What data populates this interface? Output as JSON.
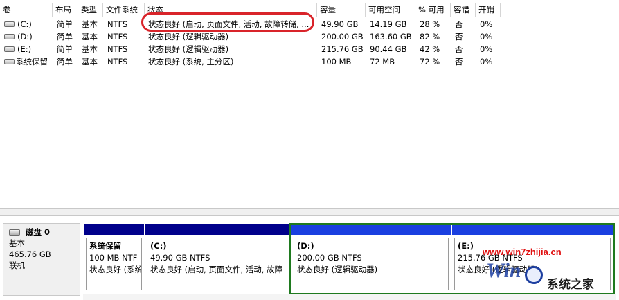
{
  "columns": [
    "卷",
    "布局",
    "类型",
    "文件系统",
    "状态",
    "容量",
    "可用空间",
    "% 可用",
    "容错",
    "开销"
  ],
  "volumes": [
    {
      "name": "(C:)",
      "layout": "简单",
      "type": "基本",
      "fs": "NTFS",
      "status": "状态良好 (启动, 页面文件, 活动, 故障转储, ...",
      "capacity": "49.90 GB",
      "free": "14.19 GB",
      "pct": "28 %",
      "fault": "否",
      "overhead": "0%"
    },
    {
      "name": "(D:)",
      "layout": "简单",
      "type": "基本",
      "fs": "NTFS",
      "status": "状态良好 (逻辑驱动器)",
      "capacity": "200.00 GB",
      "free": "163.60 GB",
      "pct": "82 %",
      "fault": "否",
      "overhead": "0%"
    },
    {
      "name": "(E:)",
      "layout": "简单",
      "type": "基本",
      "fs": "NTFS",
      "status": "状态良好 (逻辑驱动器)",
      "capacity": "215.76 GB",
      "free": "90.44 GB",
      "pct": "42 %",
      "fault": "否",
      "overhead": "0%"
    },
    {
      "name": "系统保留",
      "layout": "简单",
      "type": "基本",
      "fs": "NTFS",
      "status": "状态良好 (系统, 主分区)",
      "capacity": "100 MB",
      "free": "72 MB",
      "pct": "72 %",
      "fault": "否",
      "overhead": "0%"
    }
  ],
  "disk": {
    "name": "磁盘 0",
    "type": "基本",
    "size": "465.76 GB",
    "state": "联机"
  },
  "partitions": [
    {
      "name": "系统保留",
      "size": "100 MB NTF",
      "status": "状态良好 (系统"
    },
    {
      "name": "(C:)",
      "size": "49.90 GB NTFS",
      "status": "状态良好 (启动, 页面文件, 活动, 故障"
    },
    {
      "name": "(D:)",
      "size": "200.00 GB NTFS",
      "status": "状态良好 (逻辑驱动器)"
    },
    {
      "name": "(E:)",
      "size": "215.76 GB NTFS",
      "status": "状态良好 (逻辑驱动器)"
    }
  ],
  "watermark": {
    "url": "www.win7zhijia.cn",
    "logo": "Win",
    "site": "系统之家"
  },
  "colors": {
    "primary_bar": "#00008b",
    "logical_bar": "#1a3fe0",
    "highlight_red": "#d9242a",
    "select_green": "#1f7a1f"
  }
}
